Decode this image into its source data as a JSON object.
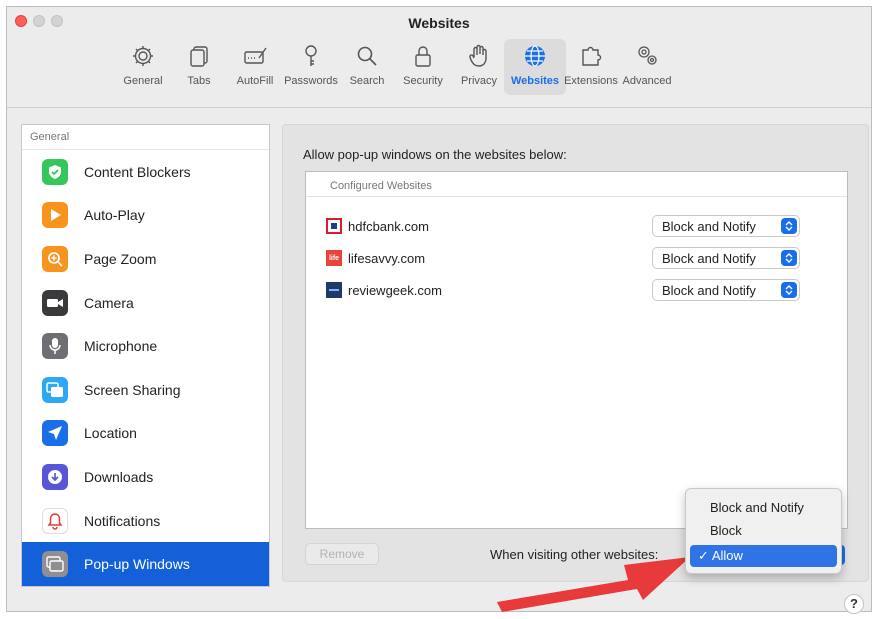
{
  "window": {
    "title": "Websites"
  },
  "toolbar": {
    "items": [
      {
        "label": "General",
        "icon": "gear-icon"
      },
      {
        "label": "Tabs",
        "icon": "tabs-icon"
      },
      {
        "label": "AutoFill",
        "icon": "autofill-icon"
      },
      {
        "label": "Passwords",
        "icon": "key-icon"
      },
      {
        "label": "Search",
        "icon": "search-icon"
      },
      {
        "label": "Security",
        "icon": "lock-icon"
      },
      {
        "label": "Privacy",
        "icon": "hand-icon"
      },
      {
        "label": "Websites",
        "icon": "globe-icon",
        "active": true
      },
      {
        "label": "Extensions",
        "icon": "puzzle-icon"
      },
      {
        "label": "Advanced",
        "icon": "gears-icon"
      }
    ]
  },
  "sidebar": {
    "header": "General",
    "items": [
      {
        "label": "Content Blockers",
        "icon": "shield-check-icon",
        "color": "#34c759"
      },
      {
        "label": "Auto-Play",
        "icon": "play-icon",
        "color": "#f7941d"
      },
      {
        "label": "Page Zoom",
        "icon": "zoom-icon",
        "color": "#f7941d"
      },
      {
        "label": "Camera",
        "icon": "camera-icon",
        "color": "#3a3a3c"
      },
      {
        "label": "Microphone",
        "icon": "microphone-icon",
        "color": "#6e6e73"
      },
      {
        "label": "Screen Sharing",
        "icon": "screen-sharing-icon",
        "color": "#2ca8f4"
      },
      {
        "label": "Location",
        "icon": "location-arrow-icon",
        "color": "#1a6ee8"
      },
      {
        "label": "Downloads",
        "icon": "download-icon",
        "color": "#5856d6"
      },
      {
        "label": "Notifications",
        "icon": "bell-icon",
        "color": "#ffffff"
      },
      {
        "label": "Pop-up Windows",
        "icon": "popup-windows-icon",
        "color": "#8e8e93",
        "selected": true
      }
    ]
  },
  "content": {
    "description": "Allow pop-up windows on the websites below:",
    "configured_header": "Configured Websites",
    "sites": [
      {
        "name": "hdfcbank.com",
        "setting": "Block and Notify",
        "favicon": "hdfc-favicon-icon"
      },
      {
        "name": "lifesavvy.com",
        "setting": "Block and Notify",
        "favicon": "lifesavvy-favicon-icon",
        "favicon_text": "life"
      },
      {
        "name": "reviewgeek.com",
        "setting": "Block and Notify",
        "favicon": "reviewgeek-favicon-icon"
      }
    ],
    "remove_label": "Remove",
    "visiting_label": "When visiting other websites:"
  },
  "dropdown": {
    "options": [
      "Block and Notify",
      "Block",
      "Allow"
    ],
    "selected": "Allow",
    "check_mark": "✓"
  },
  "help_label": "?",
  "colors": {
    "accent": "#1a6ee8",
    "arrow": "#e83a3a"
  }
}
